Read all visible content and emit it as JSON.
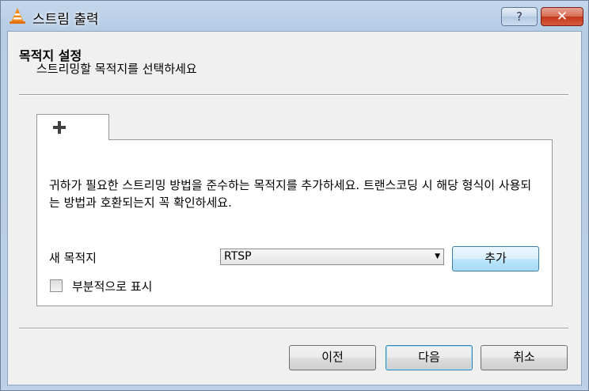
{
  "window": {
    "title": "스트림 출력",
    "help_label": "?",
    "close_label": "✕"
  },
  "header": {
    "title": "목적지 설정",
    "subtitle": "스트리밍할 목적지를 선택하세요"
  },
  "tabs": [
    {
      "label": "+",
      "icon": "plus-icon"
    }
  ],
  "panel": {
    "description": "귀하가 필요한 스트리밍 방법을 준수하는 목적지를 추가하세요. 트랜스코딩 시 해당 형식이 사용되는 방법과 호환되는지 꼭 확인하세요.",
    "new_destination_label": "새 목적지",
    "destination_select": {
      "value": "RTSP",
      "arrow": "▼"
    },
    "add_button": "추가",
    "partial_display": {
      "label": "부분적으로 표시",
      "checked": false
    }
  },
  "footer": {
    "prev_button": "이전",
    "next_button": "다음",
    "cancel_button": "취소"
  },
  "colors": {
    "title_bar": "#bcd1e8",
    "close_button": "#c2381c",
    "default_button_border": "#3c7fb1"
  }
}
